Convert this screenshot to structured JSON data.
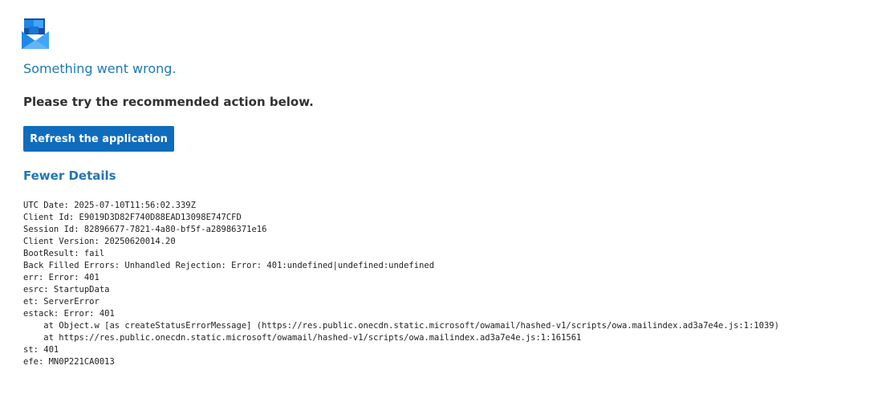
{
  "app": {
    "logo_icon": "outlook-envelope-icon",
    "colors": {
      "accent": "#0f6cbd",
      "link": "#1f78b4",
      "text": "#323130"
    }
  },
  "error": {
    "headline": "Something went wrong.",
    "subhead": "Please try the recommended action below.",
    "refresh_label": "Refresh the application",
    "details_toggle_label": "Fewer Details",
    "details_lines": [
      "UTC Date: 2025-07-10T11:56:02.339Z",
      "Client Id: E9019D3D82F740D88EAD13098E747CFD",
      "Session Id: 82896677-7821-4a80-bf5f-a28986371e16",
      "Client Version: 20250620014.20",
      "BootResult: fail",
      "Back Filled Errors: Unhandled Rejection: Error: 401:undefined|undefined:undefined",
      "err: Error: 401",
      "esrc: StartupData",
      "et: ServerError",
      "estack: Error: 401",
      "    at Object.w [as createStatusErrorMessage] (https://res.public.onecdn.static.microsoft/owamail/hashed-v1/scripts/owa.mailindex.ad3a7e4e.js:1:1039)",
      "    at https://res.public.onecdn.static.microsoft/owamail/hashed-v1/scripts/owa.mailindex.ad3a7e4e.js:1:161561",
      "st: 401",
      "efe: MN0P221CA0013"
    ]
  }
}
